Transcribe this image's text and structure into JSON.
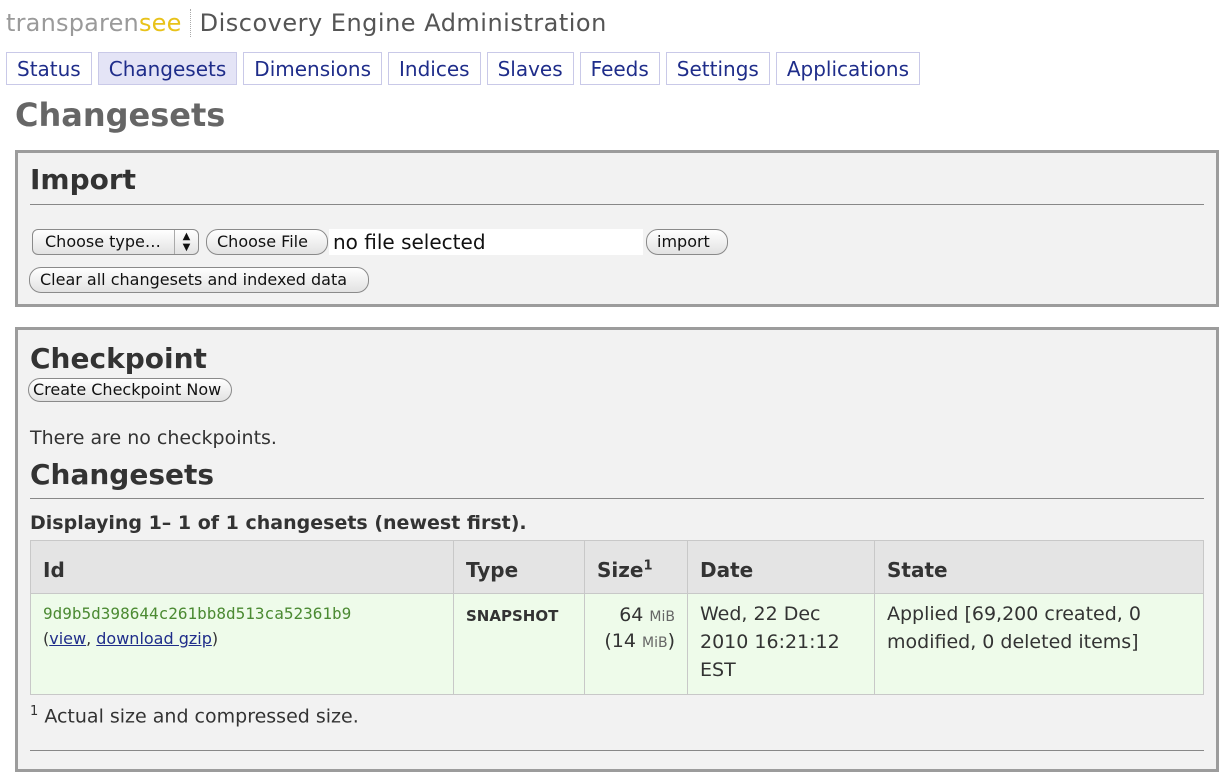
{
  "brand": {
    "logo_main": "transparen",
    "logo_accent": "see",
    "app_title": "Discovery Engine Administration"
  },
  "tabs": [
    {
      "label": "Status"
    },
    {
      "label": "Changesets"
    },
    {
      "label": "Dimensions"
    },
    {
      "label": "Indices"
    },
    {
      "label": "Slaves"
    },
    {
      "label": "Feeds"
    },
    {
      "label": "Settings"
    },
    {
      "label": "Applications"
    }
  ],
  "active_tab": "Changesets",
  "page_title": "Changesets",
  "import": {
    "heading": "Import",
    "type_select": "Choose type…",
    "choose_file": "Choose File",
    "file_status": "no file selected",
    "import_button": "import",
    "clear_button": "Clear all changesets and indexed data"
  },
  "checkpoint": {
    "heading": "Checkpoint",
    "create_button": "Create Checkpoint Now",
    "empty_text": "There are no checkpoints."
  },
  "changesets": {
    "heading": "Changesets",
    "caption": "Displaying 1– 1 of 1 changesets (newest first).",
    "columns": {
      "id": "Id",
      "type": "Type",
      "size": "Size",
      "size_sup": "1",
      "date": "Date",
      "state": "State"
    },
    "rows": [
      {
        "id": "9d9b5d398644c261bb8d513ca52361b9",
        "open_paren": "(",
        "view": "view",
        "comma": ", ",
        "download": "download gzip",
        "close_paren": ")",
        "type": "SNAPSHOT",
        "size_value": "64",
        "size_unit": "MiB",
        "compressed_value": "(14",
        "compressed_unit": "MiB",
        "compressed_close": ")",
        "date_line1": "Wed, 22 Dec",
        "date_line2": "2010 16:21:12",
        "date_line3": "EST",
        "state": "Applied [69,200 created, 0 modified, 0 deleted items]"
      }
    ],
    "footnote_mark": "1",
    "footnote": " Actual size and compressed size."
  }
}
